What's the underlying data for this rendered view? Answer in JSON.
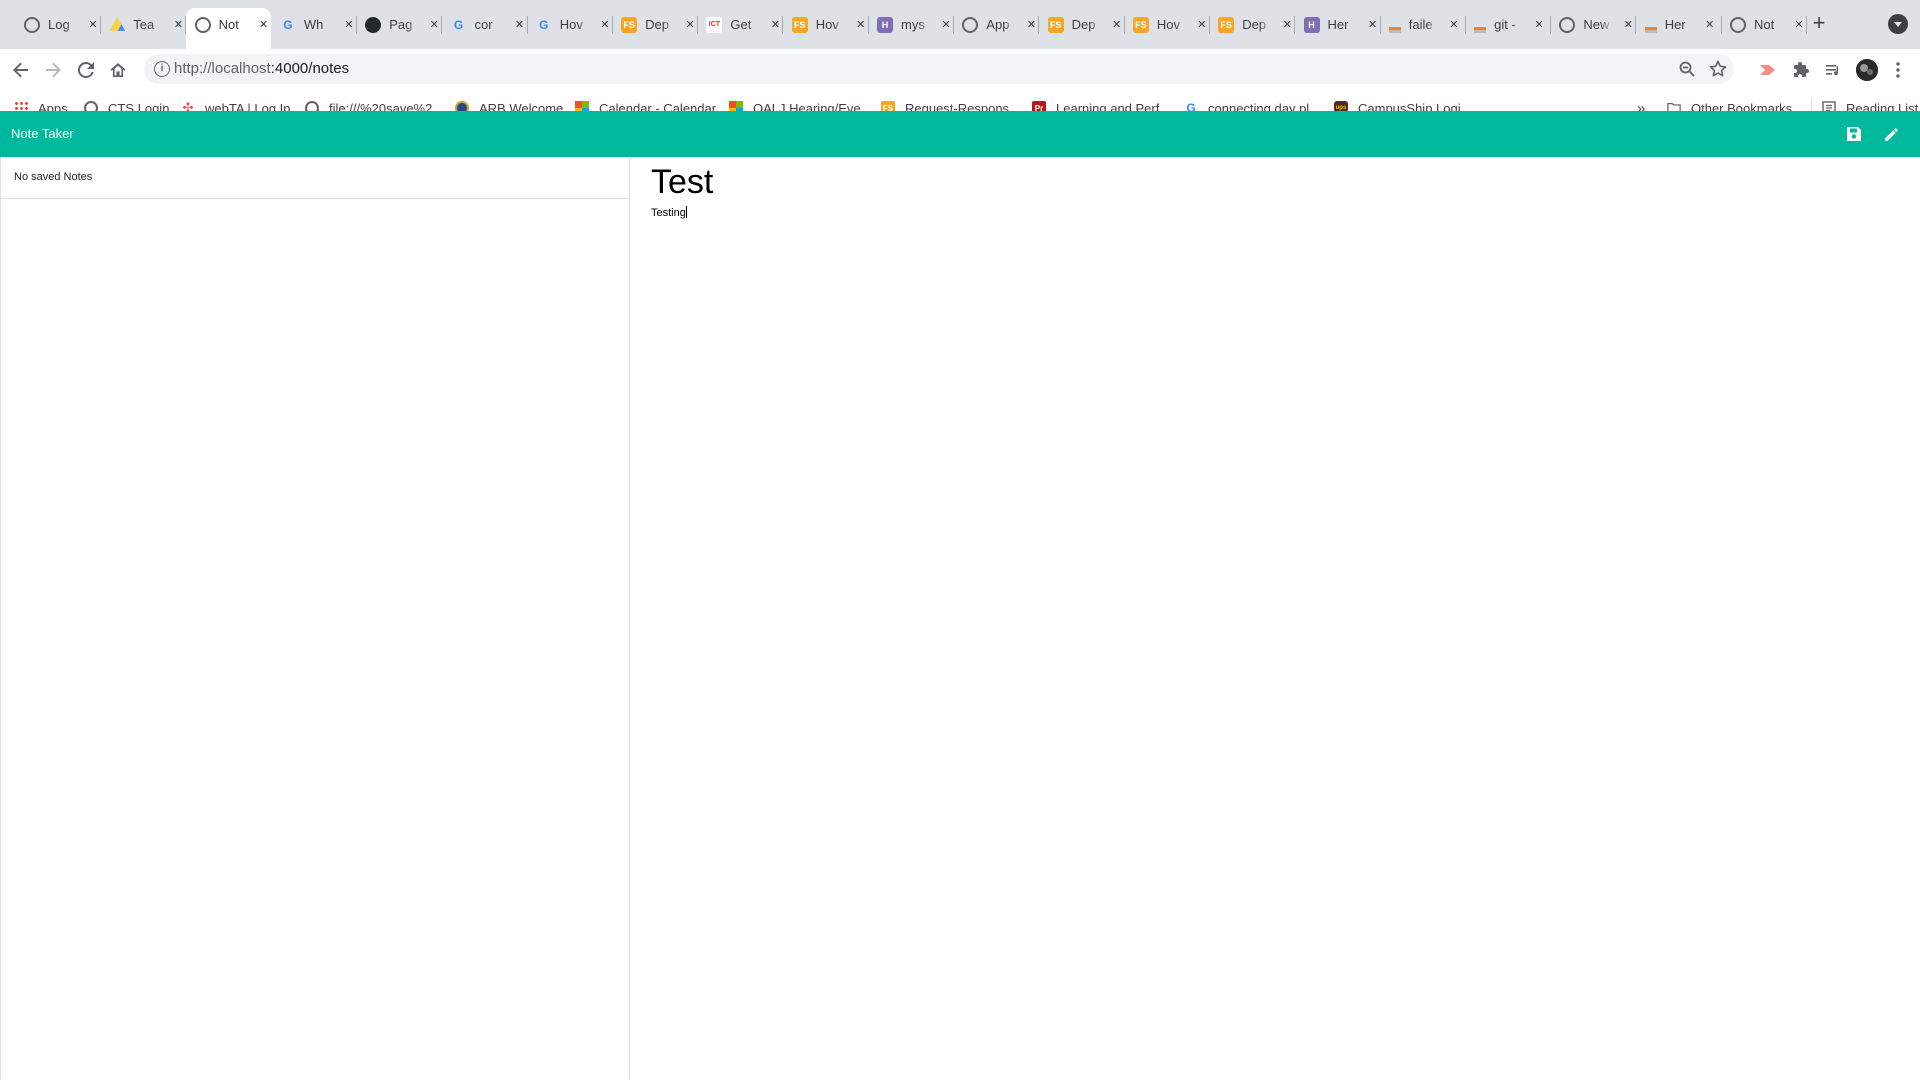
{
  "browser": {
    "tabs": [
      {
        "title": "Log",
        "fav": "globe-icon",
        "color": "#5f6368"
      },
      {
        "title": "Tea",
        "fav": "drive-icon",
        "color": "#1fa463"
      },
      {
        "title": "Not",
        "fav": "globe-icon",
        "color": "#5f6368",
        "active": true
      },
      {
        "title": "Wh",
        "fav": "google-icon",
        "color": "#4285f4"
      },
      {
        "title": "Pag",
        "fav": "github-icon",
        "color": "#24292e"
      },
      {
        "title": "cor",
        "fav": "google-icon",
        "color": "#4285f4"
      },
      {
        "title": "Hov",
        "fav": "google-icon",
        "color": "#4285f4"
      },
      {
        "title": "Dep",
        "fav": "fs-icon",
        "color": "#f5a623"
      },
      {
        "title": "Get",
        "fav": "ict-icon",
        "color": "#d93025"
      },
      {
        "title": "Hov",
        "fav": "fs-icon",
        "color": "#f5a623"
      },
      {
        "title": "mys",
        "fav": "heroku-icon",
        "color": "#7f6fb6"
      },
      {
        "title": "App",
        "fav": "globe-icon",
        "color": "#5f6368"
      },
      {
        "title": "Dep",
        "fav": "fs-icon",
        "color": "#f5a623"
      },
      {
        "title": "Hov",
        "fav": "fs-icon",
        "color": "#f5a623"
      },
      {
        "title": "Dep",
        "fav": "fs-icon",
        "color": "#f5a623"
      },
      {
        "title": "Her",
        "fav": "heroku-icon",
        "color": "#7f6fb6"
      },
      {
        "title": "faile",
        "fav": "stackoverflow-icon",
        "color": "#f48024"
      },
      {
        "title": "git -",
        "fav": "stackoverflow-icon",
        "color": "#f48024"
      },
      {
        "title": "New",
        "fav": "globe-icon",
        "color": "#5f6368"
      },
      {
        "title": "Her",
        "fav": "stackoverflow-icon",
        "color": "#f48024"
      },
      {
        "title": "Not",
        "fav": "globe-icon",
        "color": "#5f6368"
      }
    ],
    "url_host": "http://localhost",
    "url_path": ":4000/notes",
    "bookmarks": [
      {
        "label": "Apps",
        "icon": "apps-grid-icon"
      },
      {
        "label": "CTS Login",
        "icon": "globe-icon"
      },
      {
        "label": "webTA | Log In",
        "icon": "webta-icon"
      },
      {
        "label": "file:///%20save%2...",
        "icon": "globe-icon"
      },
      {
        "label": "ARB Welcome",
        "icon": "arb-icon"
      },
      {
        "label": "Calendar - Calendar",
        "icon": "microsoft-icon"
      },
      {
        "label": "OALJ Hearing/Eve...",
        "icon": "microsoft-icon"
      },
      {
        "label": "Request-Respons...",
        "icon": "fs-icon"
      },
      {
        "label": "Learning and Perf...",
        "icon": "pr-icon"
      },
      {
        "label": "connecting day pl...",
        "icon": "google-icon"
      },
      {
        "label": "CampusShip Logi...",
        "icon": "ups-icon"
      }
    ],
    "overflow": "»",
    "other_bookmarks": "Other Bookmarks",
    "reading_list": "Reading List"
  },
  "app": {
    "title": "Note Taker",
    "accent": "#00b99c",
    "sidebar_empty": "No saved Notes",
    "note_title": "Test",
    "note_text": "Testing"
  }
}
